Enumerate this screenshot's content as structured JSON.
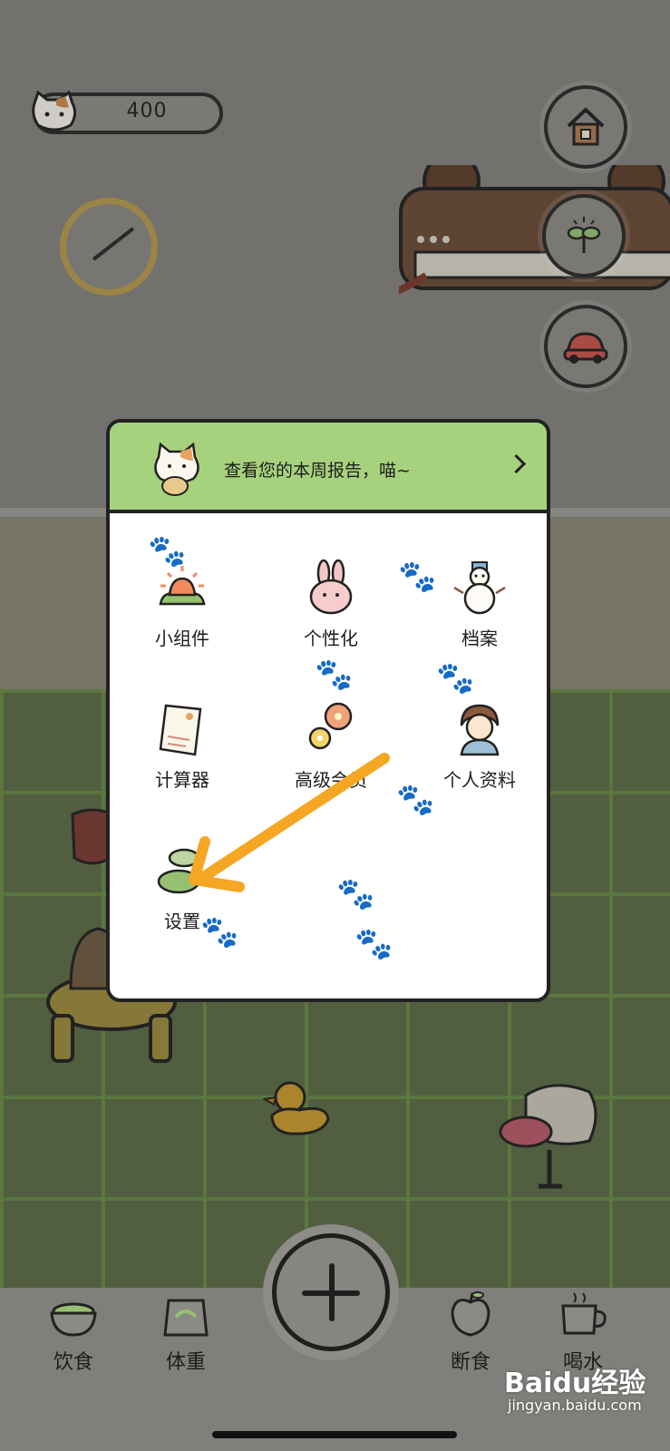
{
  "status": {
    "coins": "400"
  },
  "popup": {
    "banner_text": "查看您的本周报告，喵~",
    "items": [
      {
        "label": "小组件",
        "icon": "sunrise-icon"
      },
      {
        "label": "个性化",
        "icon": "rabbit-icon"
      },
      {
        "label": "档案",
        "icon": "snowman-icon"
      },
      {
        "label": "计算器",
        "icon": "receipt-icon"
      },
      {
        "label": "高级会员",
        "icon": "flowers-icon"
      },
      {
        "label": "个人资料",
        "icon": "person-icon"
      },
      {
        "label": "设置",
        "icon": "bush-icon"
      }
    ]
  },
  "tabbar": {
    "diet": "饮食",
    "weight": "体重",
    "fasting": "断食",
    "water": "喝水"
  },
  "watermark": {
    "brand": "Baidu经验",
    "url": "jingyan.baidu.com"
  },
  "colors": {
    "banner": "#a7d27d",
    "arrow": "#f5a623"
  }
}
